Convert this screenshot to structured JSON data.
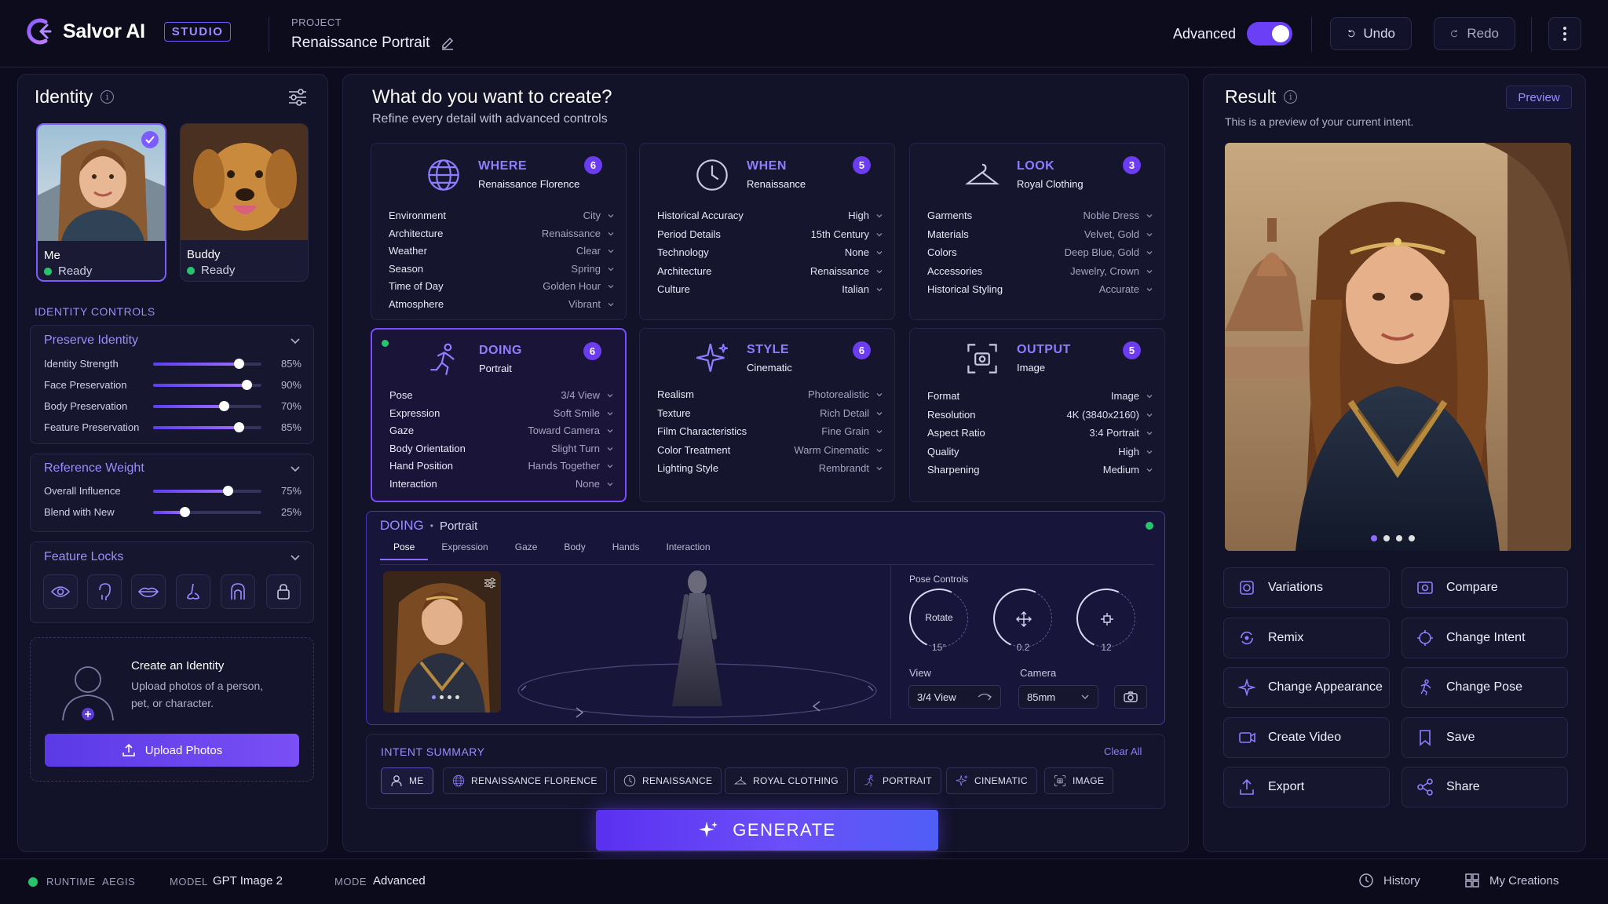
{
  "app": {
    "name": "Salvor AI",
    "badge": "STUDIO"
  },
  "project": {
    "label": "PROJECT",
    "name": "Renaissance Portrait"
  },
  "header": {
    "advanced_label": "Advanced",
    "advanced_on": true,
    "undo": "Undo",
    "redo": "Redo"
  },
  "identity": {
    "title": "Identity",
    "profiles": [
      {
        "name": "Me",
        "status": "Ready",
        "selected": true
      },
      {
        "name": "Buddy",
        "status": "Ready",
        "selected": false
      }
    ],
    "controls_title": "IDENTITY CONTROLS",
    "preserve": {
      "title": "Preserve Identity",
      "sliders": [
        {
          "label": "Identity Strength",
          "value": "85%",
          "level": 0.79
        },
        {
          "label": "Face Preservation",
          "value": "90%",
          "level": 0.86
        },
        {
          "label": "Body Preservation",
          "value": "70%",
          "level": 0.65
        },
        {
          "label": "Feature Preservation",
          "value": "85%",
          "level": 0.79
        }
      ]
    },
    "reference": {
      "title": "Reference Weight",
      "sliders": [
        {
          "label": "Overall Influence",
          "value": "75%",
          "level": 0.69
        },
        {
          "label": "Blend with New",
          "value": "25%",
          "level": 0.29
        }
      ]
    },
    "feature_locks": {
      "title": "Feature Locks",
      "icons": [
        "eye-icon",
        "face-icon",
        "lips-icon",
        "nose-icon",
        "hair-icon",
        "lock-icon"
      ]
    },
    "create": {
      "title": "Create an Identity",
      "desc_line1": "Upload photos of a person,",
      "desc_line2": "pet, or character.",
      "button": "Upload Photos"
    }
  },
  "main": {
    "heading": "What do you want to create?",
    "subheading": "Refine every detail with advanced controls",
    "cards": [
      {
        "key": "where",
        "title": "WHERE",
        "subtitle": "Renaissance Florence",
        "count": "6",
        "icon": "globe-icon",
        "rows": [
          [
            "Environment",
            "City"
          ],
          [
            "Architecture",
            "Renaissance"
          ],
          [
            "Weather",
            "Clear"
          ],
          [
            "Season",
            "Spring"
          ],
          [
            "Time of Day",
            "Golden Hour"
          ],
          [
            "Atmosphere",
            "Vibrant"
          ]
        ]
      },
      {
        "key": "when",
        "title": "WHEN",
        "subtitle": "Renaissance",
        "count": "5",
        "icon": "clock-icon",
        "rows": [
          [
            "Historical Accuracy",
            "High"
          ],
          [
            "Period Details",
            "15th Century"
          ],
          [
            "Technology",
            "None"
          ],
          [
            "Architecture",
            "Renaissance"
          ],
          [
            "Culture",
            "Italian"
          ]
        ]
      },
      {
        "key": "look",
        "title": "LOOK",
        "subtitle": "Royal Clothing",
        "count": "3",
        "icon": "hanger-icon",
        "rows": [
          [
            "Garments",
            "Noble Dress"
          ],
          [
            "Materials",
            "Velvet, Gold"
          ],
          [
            "Colors",
            "Deep Blue, Gold"
          ],
          [
            "Accessories",
            "Jewelry, Crown"
          ],
          [
            "Historical Styling",
            "Accurate"
          ]
        ]
      },
      {
        "key": "doing",
        "title": "DOING",
        "subtitle": "Portrait",
        "count": "6",
        "icon": "running-icon",
        "rows": [
          [
            "Pose",
            "3/4 View"
          ],
          [
            "Expression",
            "Soft Smile"
          ],
          [
            "Gaze",
            "Toward Camera"
          ],
          [
            "Body Orientation",
            "Slight Turn"
          ],
          [
            "Hand Position",
            "Hands Together"
          ],
          [
            "Interaction",
            "None"
          ]
        ]
      },
      {
        "key": "style",
        "title": "STYLE",
        "subtitle": "Cinematic",
        "count": "6",
        "icon": "sparkle-icon",
        "rows": [
          [
            "Realism",
            "Photorealistic"
          ],
          [
            "Texture",
            "Rich Detail"
          ],
          [
            "Film Characteristics",
            "Fine Grain"
          ],
          [
            "Color Treatment",
            "Warm Cinematic"
          ],
          [
            "Lighting Style",
            "Rembrandt"
          ]
        ]
      },
      {
        "key": "output",
        "title": "OUTPUT",
        "subtitle": "Image",
        "count": "5",
        "icon": "frame-icon",
        "rows": [
          [
            "Format",
            "Image"
          ],
          [
            "Resolution",
            "4K (3840x2160)"
          ],
          [
            "Aspect Ratio",
            "3:4 Portrait"
          ],
          [
            "Quality",
            "High"
          ],
          [
            "Sharpening",
            "Medium"
          ]
        ]
      }
    ],
    "doing_panel": {
      "title": "DOING",
      "subtitle": "Portrait",
      "tabs": [
        "Pose",
        "Expression",
        "Gaze",
        "Body",
        "Hands",
        "Interaction"
      ],
      "pose_controls_label": "Pose Controls",
      "dials": [
        {
          "label": "Rotate",
          "value": "15°"
        },
        {
          "label": "",
          "value": "0.2"
        },
        {
          "label": "",
          "value": "12"
        }
      ],
      "view_label": "View",
      "view_value": "3/4 View",
      "camera_label": "Camera",
      "camera_value": "85mm"
    },
    "summary": {
      "title": "INTENT SUMMARY",
      "clear": "Clear All",
      "chips": [
        {
          "label": "ME",
          "icon": "user-icon"
        },
        {
          "label": "RENAISSANCE FLORENCE",
          "icon": "globe-icon"
        },
        {
          "label": "RENAISSANCE",
          "icon": "clock-icon"
        },
        {
          "label": "ROYAL CLOTHING",
          "icon": "hanger-icon"
        },
        {
          "label": "PORTRAIT",
          "icon": "running-icon"
        },
        {
          "label": "CINEMATIC",
          "icon": "sparkle-icon"
        },
        {
          "label": "IMAGE",
          "icon": "frame-icon"
        }
      ]
    },
    "generate": "GENERATE"
  },
  "result": {
    "title": "Result",
    "preview_button": "Preview",
    "desc": "This is a preview of your current intent.",
    "actions": [
      "Variations",
      "Compare",
      "Remix",
      "Change Intent",
      "Change Appearance",
      "Change Pose",
      "Create Video",
      "Save",
      "Export",
      "Share"
    ]
  },
  "statusbar": {
    "runtime_label": "RUNTIME",
    "runtime_value": "AEGIS",
    "model_label": "MODEL",
    "model_value": "GPT Image 2",
    "mode_label": "MODE",
    "mode_value": "Advanced",
    "history": "History",
    "my_creations": "My Creations"
  },
  "colors": {
    "accent": "#6a3ff5",
    "accent_light": "#8f7dff",
    "ready": "#27c46b",
    "bg": "#0c0c1e",
    "panel": "#121228"
  }
}
